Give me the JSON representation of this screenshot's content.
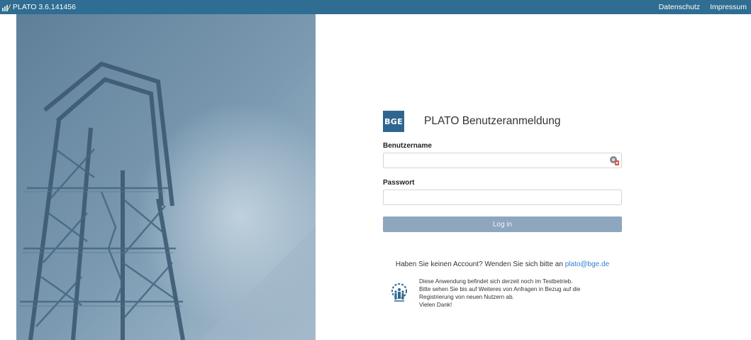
{
  "topbar": {
    "app_name": "PLATO 3.6.141456",
    "links": [
      "Datenschutz",
      "Impressum"
    ]
  },
  "login": {
    "logo_text": "BGE",
    "title": "PLATO Benutzeranmeldung",
    "username_label": "Benutzername",
    "username_value": "",
    "password_label": "Passwort",
    "password_value": "",
    "button_label": "Log in"
  },
  "account": {
    "prefix": "Haben Sie keinen Account? Wenden Sie sich bitte an",
    "email": "plato@bge.de"
  },
  "info": {
    "lines": [
      "Diese Anwendung befindet sich derzeit noch im Testbetrieb.",
      "Bitte sehen Sie bis auf Weiteres von Anfragen in Bezug auf die",
      "Registrierung von neuen Nutzern ab.",
      "Vielen Dank!"
    ]
  },
  "icons": {
    "app": "app-logo-icon",
    "password_manager": "password-manager-icon",
    "info": "team-gear-icon"
  },
  "colors": {
    "topbar": "#2f6d92",
    "logo": "#2f6690",
    "button": "#8fa6bf",
    "link": "#2f7fd1"
  }
}
